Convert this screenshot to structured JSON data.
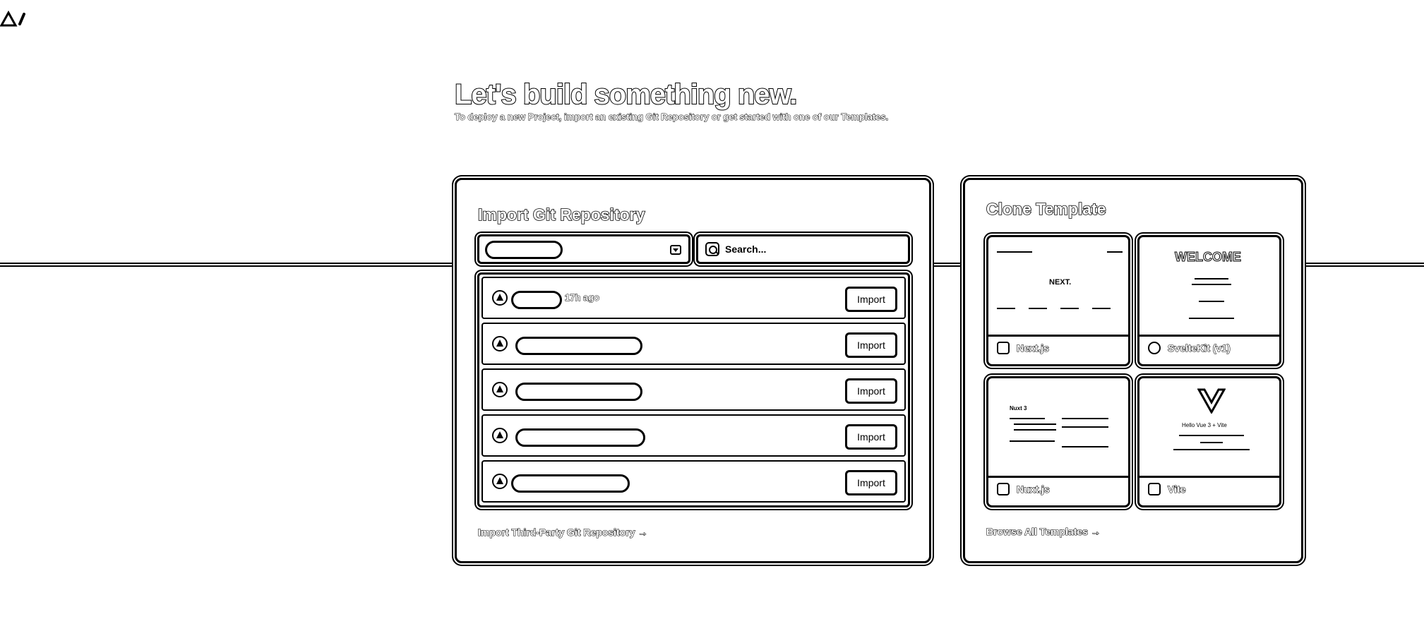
{
  "hero": {
    "title": "Let's build something new.",
    "subtitle": "To deploy a new Project, import an existing Git Repository or get started with one of our Templates."
  },
  "import_panel": {
    "title": "Import Git Repository",
    "search_placeholder": "Search...",
    "repos": [
      {
        "time": "17h ago",
        "button": "Import"
      },
      {
        "time": "",
        "button": "Import"
      },
      {
        "time": "",
        "button": "Import"
      },
      {
        "time": "",
        "button": "Import"
      },
      {
        "time": "",
        "button": "Import"
      }
    ],
    "footer_link": "Import Third-Party Git Repository →"
  },
  "clone_panel": {
    "title": "Clone Template",
    "templates": [
      {
        "name": "Next.js",
        "icon": "nextjs-icon",
        "preview_text": "NEXT."
      },
      {
        "name": "SvelteKit (v1)",
        "icon": "svelte-icon",
        "preview_text": "WELCOME"
      },
      {
        "name": "Nuxt.js",
        "icon": "nuxt-icon",
        "preview_text": "Nuxt 3"
      },
      {
        "name": "Vite",
        "icon": "vite-icon",
        "preview_text": "Hello Vue 3 + Vite"
      }
    ],
    "footer_link": "Browse All Templates →"
  }
}
